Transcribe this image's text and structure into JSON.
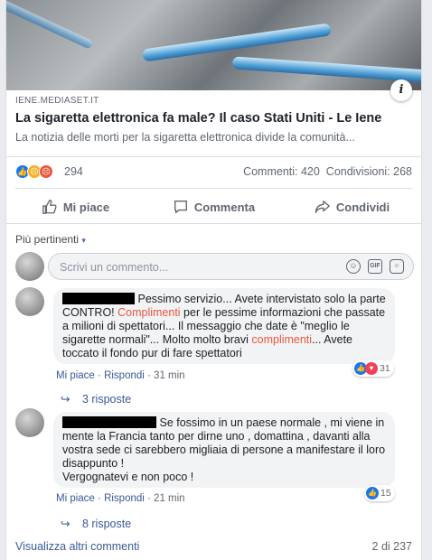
{
  "link": {
    "source": "IENE.MEDIASET.IT",
    "title": "La sigaretta elettronica fa male? Il caso Stati Uniti - Le Iene",
    "description": "La notizia delle morti per la sigaretta elettronica divide la comunità...",
    "info_glyph": "i"
  },
  "stats": {
    "reactions_count": "294",
    "comments": "Commenti: 420",
    "shares": "Condivisioni: 268",
    "reaction_icons": [
      "like-icon",
      "sad-icon",
      "angry-icon"
    ]
  },
  "actions": {
    "like": "Mi piace",
    "comment": "Commenta",
    "share": "Condividi"
  },
  "sort": {
    "label": "Più pertinenti",
    "chevron": "▾"
  },
  "composer": {
    "placeholder": "Scrivi un commento...",
    "gif_label": "GIF"
  },
  "comments": [
    {
      "text_before": "Pessimo servizio... Avete intervistato solo la parte CONTRO! ",
      "highlight_1": "Complimenti",
      "text_middle": " per le pessime informazioni che passate a milioni di spettatori... Il messaggio che date è \"meglio le sigarette normali\"... Molto molto bravi ",
      "highlight_2": "complimenti",
      "text_after": "... Avete toccato il fondo pur di fare spettatori",
      "like": "Mi piace",
      "sep": " · ",
      "reply": "Rispondi",
      "time": "31 min",
      "reaction_count": "31",
      "replies_arrow": "↪",
      "replies": "3 risposte"
    },
    {
      "text_line1": "Se fossimo in un paese normale , mi viene in mente la Francia tanto per dirne uno , domattina , davanti alla vostra sede ci sarebbero migliaia di persone a manifestare il loro disappunto !",
      "text_line2": "Vergognatevi e non poco !",
      "like": "Mi piace",
      "sep": " · ",
      "reply": "Rispondi",
      "time": "21 min",
      "reaction_count": "15",
      "replies_arrow": "↪",
      "replies": "8 risposte"
    }
  ],
  "footer": {
    "more": "Visualizza altri commenti",
    "pager": "2 di 237"
  },
  "colors": {
    "like_blue": "#1877f2",
    "love_red": "#f33e58",
    "angry_orange": "#e9573e",
    "link_blue": "#385898"
  }
}
